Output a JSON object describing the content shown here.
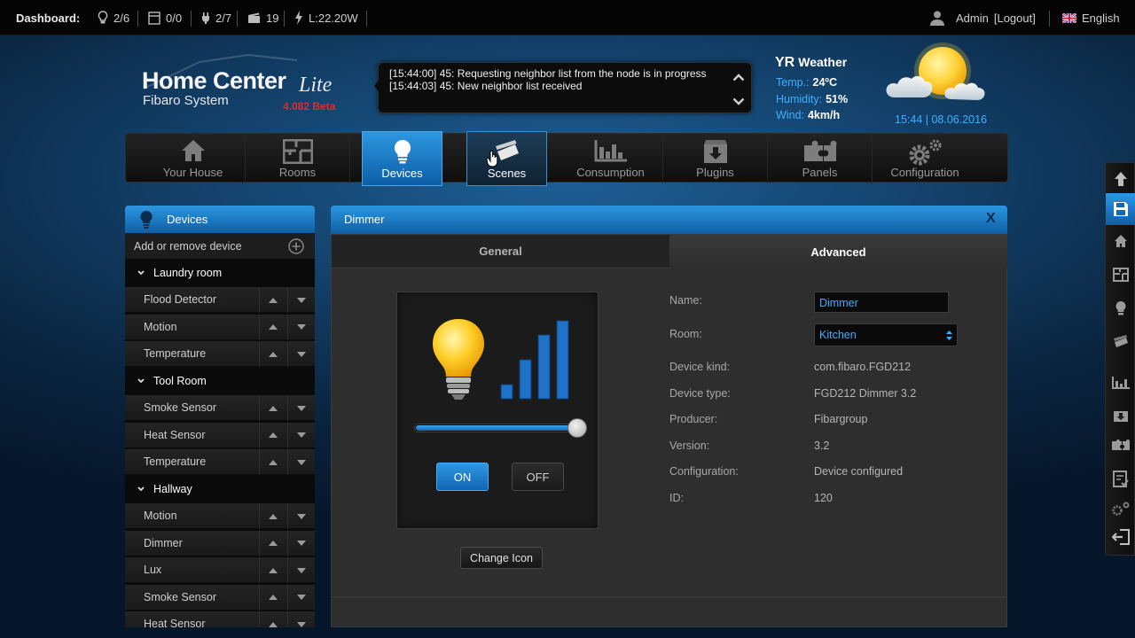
{
  "topbar": {
    "dashboard_label": "Dashboard:",
    "lights": "2/6",
    "blinds": "0/0",
    "outlets": "2/7",
    "scenes": "19",
    "power": "L:22.20W",
    "user": "Admin",
    "logout": "[Logout]",
    "language": "English"
  },
  "logo": {
    "title": "Home Center",
    "subtitle": "Fibaro System",
    "edition": "Lite",
    "version": "4.082 Beta"
  },
  "log": [
    "[15:44:00] 45: Requesting neighbor list from the node is in progress",
    "[15:44:03] 45: New neighbor list received"
  ],
  "weather": {
    "brand": "YR",
    "title": "Weather",
    "temp_label": "Temp.:",
    "temp": "24ºC",
    "humidity_label": "Humidity:",
    "humidity": "51%",
    "wind_label": "Wind:",
    "wind": "4km/h",
    "datetime": "15:44 | 08.06.2016"
  },
  "nav": {
    "items": [
      {
        "label": "Your House",
        "icon": "house-icon"
      },
      {
        "label": "Rooms",
        "icon": "rooms-icon"
      },
      {
        "label": "Devices",
        "icon": "bulb-icon",
        "active": true
      },
      {
        "label": "Scenes",
        "icon": "clapperboard-icon"
      },
      {
        "label": "Consumption",
        "icon": "bar-chart-icon"
      },
      {
        "label": "Plugins",
        "icon": "box-download-icon"
      },
      {
        "label": "Panels",
        "icon": "puzzle-icon"
      },
      {
        "label": "Configuration",
        "icon": "gears-icon"
      }
    ]
  },
  "sidebar": {
    "title": "Devices",
    "add_label": "Add or remove device",
    "rooms": [
      {
        "name": "Laundry room",
        "devices": [
          "Flood Detector",
          "Motion",
          "Temperature"
        ]
      },
      {
        "name": "Tool Room",
        "devices": [
          "Smoke Sensor",
          "Heat Sensor",
          "Temperature"
        ]
      },
      {
        "name": "Hallway",
        "devices": [
          "Motion",
          "Dimmer",
          "Lux",
          "Smoke Sensor",
          "Heat Sensor"
        ]
      }
    ]
  },
  "panel": {
    "title": "Dimmer",
    "close": "X",
    "tabs": {
      "general": "General",
      "advanced": "Advanced"
    },
    "device": {
      "level": 0.97,
      "on_label": "ON",
      "off_label": "OFF",
      "change_icon": "Change Icon"
    },
    "props": {
      "name_label": "Name:",
      "name_value": "Dimmer",
      "room_label": "Room:",
      "room_value": "Kitchen",
      "kind_label": "Device kind:",
      "kind_value": "com.fibaro.FGD212",
      "type_label": "Device type:",
      "type_value": "FGD212 Dimmer 3.2",
      "producer_label": "Producer:",
      "producer_value": "Fibargroup",
      "version_label": "Version:",
      "version_value": "3.2",
      "config_label": "Configuration:",
      "config_value": "Device configured",
      "id_label": "ID:",
      "id_value": "120"
    }
  },
  "colors": {
    "accent": "#1e88d8",
    "link": "#3fb0ff",
    "version": "#e02b2b"
  }
}
